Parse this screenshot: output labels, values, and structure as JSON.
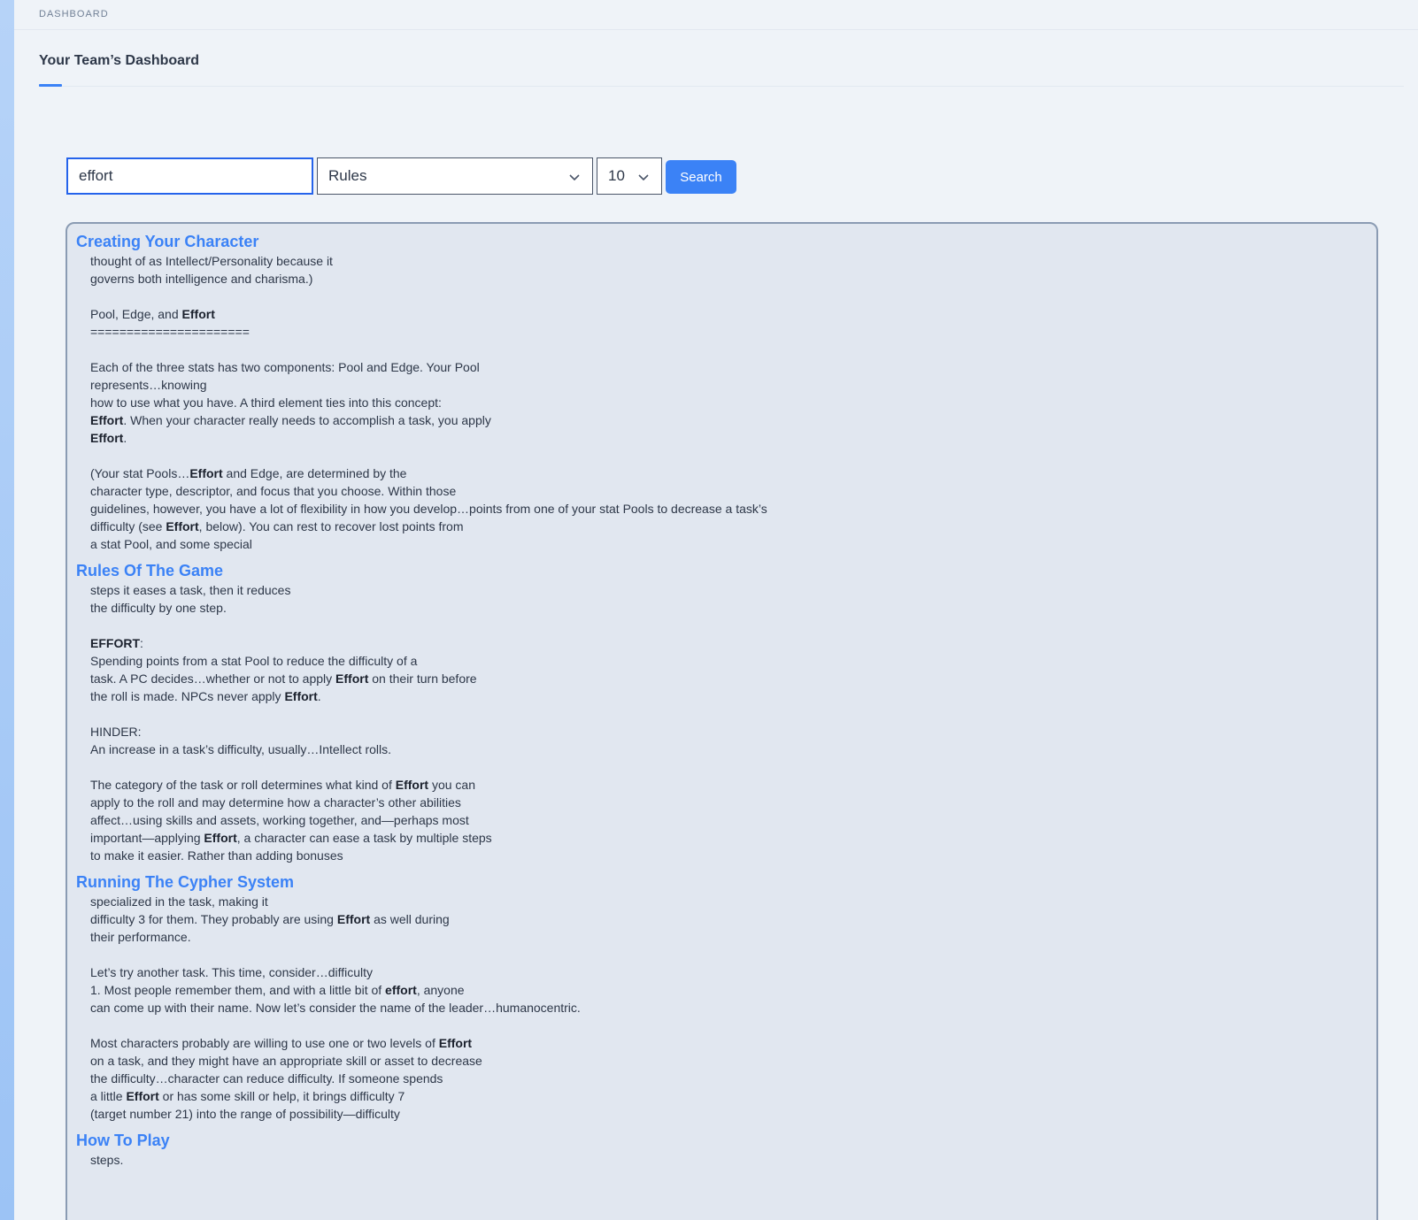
{
  "breadcrumb": "DASHBOARD",
  "tab": {
    "label": "Your Team’s Dashboard"
  },
  "search": {
    "query": "effort",
    "category": "Rules",
    "count": "10",
    "button_label": "Search"
  },
  "results": [
    {
      "title": "Creating Your Character",
      "lines": [
        [
          {
            "t": "thought of as Intellect/Personality because it"
          }
        ],
        [
          {
            "t": "governs both intelligence and charisma.)"
          }
        ],
        [],
        [
          {
            "t": "Pool, Edge, and "
          },
          {
            "t": "Effort",
            "b": true
          }
        ],
        [
          {
            "t": "======================"
          }
        ],
        [],
        [
          {
            "t": "Each of the three stats has two components: Pool and Edge. Your Pool"
          }
        ],
        [
          {
            "t": "represents…knowing"
          }
        ],
        [
          {
            "t": "how to use what you have. A third element ties into this concept:"
          }
        ],
        [
          {
            "t": "Effort",
            "b": true
          },
          {
            "t": ". When your character really needs to accomplish a task, you apply"
          }
        ],
        [
          {
            "t": "Effort",
            "b": true
          },
          {
            "t": "."
          }
        ],
        [],
        [
          {
            "t": "(Your stat Pools…"
          },
          {
            "t": "Effort",
            "b": true
          },
          {
            "t": " and Edge, are determined by the"
          }
        ],
        [
          {
            "t": "character type, descriptor, and focus that you choose. Within those"
          }
        ],
        [
          {
            "t": "guidelines, however, you have a lot of flexibility in how you develop…points from one of your stat Pools to decrease a task’s"
          }
        ],
        [
          {
            "t": "difficulty (see "
          },
          {
            "t": "Effort",
            "b": true
          },
          {
            "t": ", below). You can rest to recover lost points from"
          }
        ],
        [
          {
            "t": "a stat Pool, and some special"
          }
        ]
      ]
    },
    {
      "title": "Rules Of The Game",
      "lines": [
        [
          {
            "t": "steps it eases a task, then it reduces"
          }
        ],
        [
          {
            "t": "the difficulty by one step."
          }
        ],
        [],
        [
          {
            "t": "EFFORT",
            "b": true
          },
          {
            "t": ":"
          }
        ],
        [
          {
            "t": "Spending points from a stat Pool to reduce the difficulty of a"
          }
        ],
        [
          {
            "t": "task. A PC decides…whether or not to apply "
          },
          {
            "t": "Effort",
            "b": true
          },
          {
            "t": " on their turn before"
          }
        ],
        [
          {
            "t": "the roll is made. NPCs never apply "
          },
          {
            "t": "Effort",
            "b": true
          },
          {
            "t": "."
          }
        ],
        [],
        [
          {
            "t": "HINDER:"
          }
        ],
        [
          {
            "t": "An increase in a task’s difficulty, usually…Intellect rolls."
          }
        ],
        [],
        [
          {
            "t": "The category of the task or roll determines what kind of "
          },
          {
            "t": "Effort",
            "b": true
          },
          {
            "t": " you can"
          }
        ],
        [
          {
            "t": "apply to the roll and may determine how a character’s other abilities"
          }
        ],
        [
          {
            "t": "affect…using skills and assets, working together, and—perhaps most"
          }
        ],
        [
          {
            "t": "important—applying "
          },
          {
            "t": "Effort",
            "b": true
          },
          {
            "t": ", a character can ease a task by multiple steps"
          }
        ],
        [
          {
            "t": "to make it easier. Rather than adding bonuses"
          }
        ]
      ]
    },
    {
      "title": "Running The Cypher System",
      "lines": [
        [
          {
            "t": "specialized in the task, making it"
          }
        ],
        [
          {
            "t": "difficulty 3 for them. They probably are using "
          },
          {
            "t": "Effort",
            "b": true
          },
          {
            "t": " as well during"
          }
        ],
        [
          {
            "t": "their performance."
          }
        ],
        [],
        [
          {
            "t": "Let’s try another task. This time, consider…difficulty"
          }
        ],
        [
          {
            "t": "1. Most people remember them, and with a little bit of "
          },
          {
            "t": "effort",
            "b": true
          },
          {
            "t": ", anyone"
          }
        ],
        [
          {
            "t": "can come up with their name. Now let’s consider the name of the leader…humanocentric."
          }
        ],
        [],
        [
          {
            "t": "Most characters probably are willing to use one or two levels of "
          },
          {
            "t": "Effort",
            "b": true
          }
        ],
        [
          {
            "t": "on a task, and they might have an appropriate skill or asset to decrease"
          }
        ],
        [
          {
            "t": "the difficulty…character can reduce difficulty. If someone spends"
          }
        ],
        [
          {
            "t": "a little "
          },
          {
            "t": "Effort",
            "b": true
          },
          {
            "t": " or has some skill or help, it brings difficulty 7"
          }
        ],
        [
          {
            "t": "(target number 21) into the range of possibility—difficulty"
          }
        ]
      ]
    },
    {
      "title": "How To Play",
      "lines": [
        [
          {
            "t": "steps."
          }
        ]
      ]
    }
  ]
}
